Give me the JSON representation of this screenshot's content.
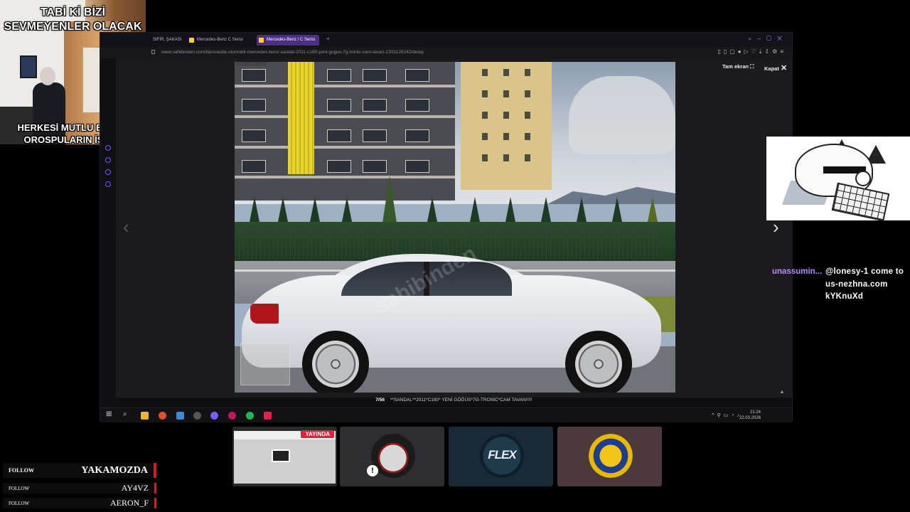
{
  "webcam": {
    "top_text": "TABİ Kİ BİZİ SEVMEYENLER OLACAK",
    "bottom_text": "HERKESİ MUTLU ETMEK OROSPULARIN İSİDİR"
  },
  "browser": {
    "tabs": [
      {
        "label": "SIFIR, ŞAKASI"
      },
      {
        "label": "Mercedes-Benz C Serisi"
      },
      {
        "label": "Mercedes-Benz / C Serisi"
      }
    ],
    "url": "www.sahibinden.com/ilan/vasita-otomobil-mercedes-benz-sandal-2011-c180-yeni-gogus-7g-tronic-cam-tavan-1303128242/detay"
  },
  "viewer": {
    "fullscreen_label": "Tam ekran",
    "close_label": "Kapat",
    "photo_id": "#1303128242",
    "watermark": "sahibinden",
    "counter": "7/56",
    "caption": "**SANDAL**2011*C180* YENİ GÖĞÜS*7G-TRONİC*CAM TAVAN!!!!!"
  },
  "taskbar": {
    "time": "21:24",
    "date": "22.03.2026"
  },
  "chat": {
    "user": "unassumin...",
    "message": "@lonesy-1 come to us-nezhna.com kYKnuXd"
  },
  "cards": {
    "live_badge": "YAYINDA",
    "flex_logo": "FLEX"
  },
  "follows": [
    {
      "label": "FOLLOW",
      "name": "YAKAMOZDA"
    },
    {
      "label": "FOLLOW",
      "name": "AY4VZ"
    },
    {
      "label": "FOLLOW",
      "name": "AERON_F"
    }
  ],
  "colors": {
    "active_tab": "#4c2e87",
    "chat_user": "#b38cff",
    "follow_accent": "#d61a2a",
    "live_badge": "#e02437"
  }
}
